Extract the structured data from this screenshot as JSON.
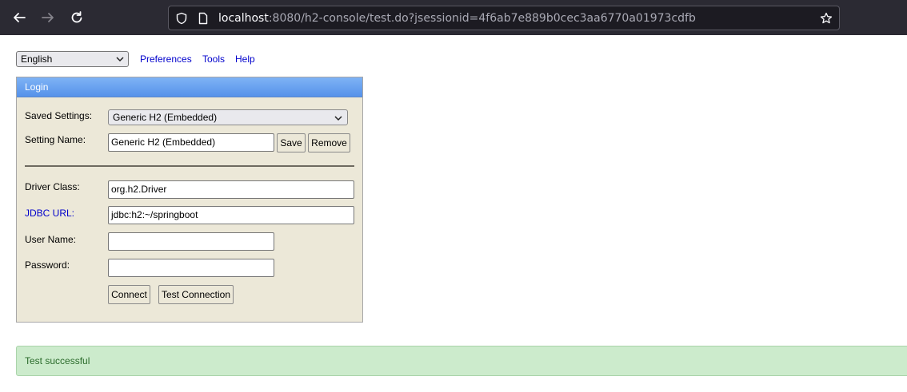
{
  "browser": {
    "url_host": "localhost",
    "url_rest": ":8080/h2-console/test.do?jsessionid=4f6ab7e889b0cec3aa6770a01973cdfb"
  },
  "toolbar": {
    "language": "English",
    "preferences": "Preferences",
    "tools": "Tools",
    "help": "Help"
  },
  "login": {
    "title": "Login",
    "saved_settings_label": "Saved Settings:",
    "saved_settings_value": "Generic H2 (Embedded)",
    "setting_name_label": "Setting Name:",
    "setting_name_value": "Generic H2 (Embedded)",
    "save": "Save",
    "remove": "Remove",
    "driver_class_label": "Driver Class:",
    "driver_class_value": "org.h2.Driver",
    "jdbc_url_label": "JDBC URL:",
    "jdbc_url_value": "jdbc:h2:~/springboot",
    "user_name_label": "User Name:",
    "user_name_value": "",
    "password_label": "Password:",
    "password_value": "",
    "connect": "Connect",
    "test_connection": "Test Connection"
  },
  "status": {
    "message": "Test successful"
  },
  "colors": {
    "chrome": "#2b2a33",
    "panel": "#ece8d8",
    "title_bar": "#6aa1ef",
    "link": "#0000cc",
    "success_bg": "#ccebcc"
  }
}
